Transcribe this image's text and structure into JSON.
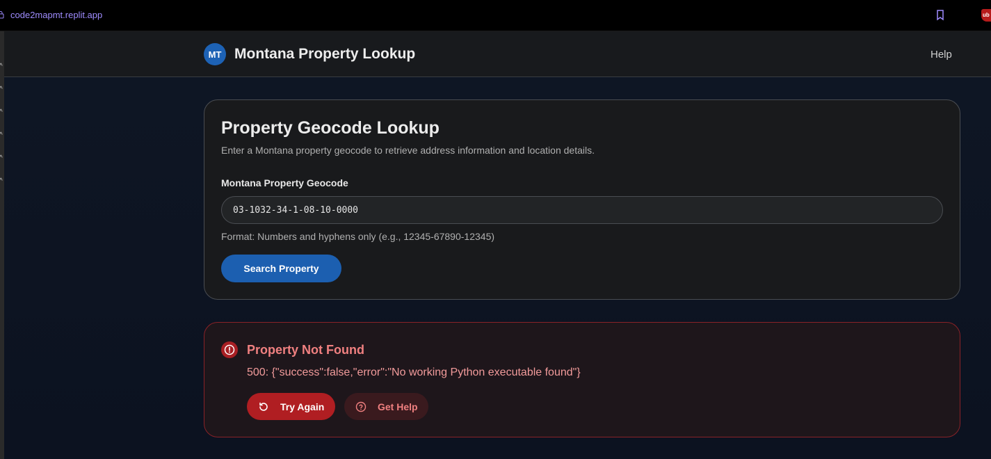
{
  "browser": {
    "url": "code2mapmt.replit.app"
  },
  "header": {
    "logo_text": "MT",
    "title": "Montana Property Lookup",
    "help_label": "Help"
  },
  "search_card": {
    "title": "Property Geocode Lookup",
    "description": "Enter a Montana property geocode to retrieve address information and location details.",
    "field_label": "Montana Property Geocode",
    "input_value": "03-1032-34-1-08-10-0000",
    "format_hint": "Format: Numbers and hyphens only (e.g., 12345-67890-12345)",
    "search_button": "Search Property"
  },
  "error_card": {
    "title": "Property Not Found",
    "message": "500: {\"success\":false,\"error\":\"No working Python executable found\"}",
    "try_again_label": "Try Again",
    "get_help_label": "Get Help"
  },
  "icons": {
    "lock": "lock-icon",
    "bookmark": "bookmark-icon",
    "ublock": "ublock-origin-icon",
    "error": "alert-circle-icon",
    "retry": "rotate-ccw-icon",
    "help": "help-circle-icon"
  },
  "colors": {
    "accent_blue": "#1c5fb0",
    "error_red": "#b01e22",
    "error_text": "#f08080",
    "url_purple": "#9f8cff"
  }
}
